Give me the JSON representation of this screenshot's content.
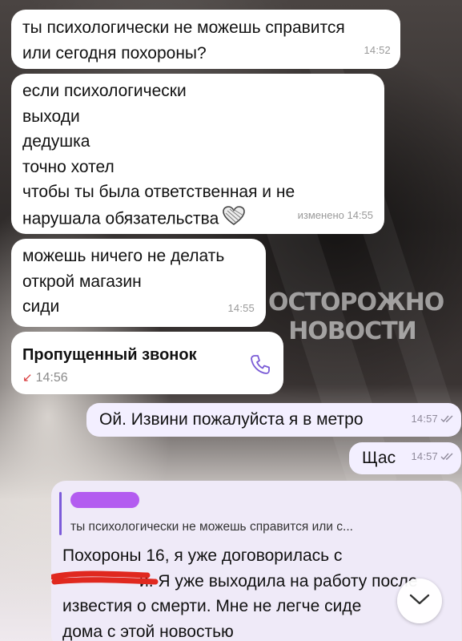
{
  "messages": [
    {
      "lines": [
        "ты психологически не можешь справится",
        "или сегодня похороны?"
      ],
      "time": "14:52"
    },
    {
      "lines": [
        "если психологически",
        "выходи",
        "дедушка",
        "точно хотел",
        "чтобы ты была ответственная и не",
        "нарушала обязательства"
      ],
      "edited": "изменено 14:55"
    },
    {
      "lines": [
        "можешь ничего не делать",
        "открой магазин",
        "сиди"
      ],
      "time": "14:55"
    },
    {
      "call_title": "Пропущенный звонок",
      "call_time": "14:56"
    },
    {
      "text": "Ой. Извини пожалуйста я в метро",
      "time": "14:57"
    },
    {
      "text": "Щас",
      "time": "14:57"
    },
    {
      "quote_text": "ты психологически не можешь справится или с...",
      "lines": [
        "Похороны 16, я уже договорилась с",
        "и. Я уже выходила на работу после",
        "известия о смерти. Мне не легче сиде",
        "дома с этой новостью"
      ]
    }
  ],
  "watermark": [
    "ОСТОРОЖНО",
    "НОВОСТИ"
  ],
  "icons": {
    "phone": "phone-icon",
    "missed": "missed-call-arrow-icon",
    "read": "double-check-icon",
    "reaction": "heart-icon",
    "scroll": "chevron-down-icon"
  },
  "colors": {
    "incoming": "#ffffff",
    "outgoing": "#f3efff",
    "quote_accent": "#7c5bd9",
    "missed_red": "#d9383a"
  }
}
